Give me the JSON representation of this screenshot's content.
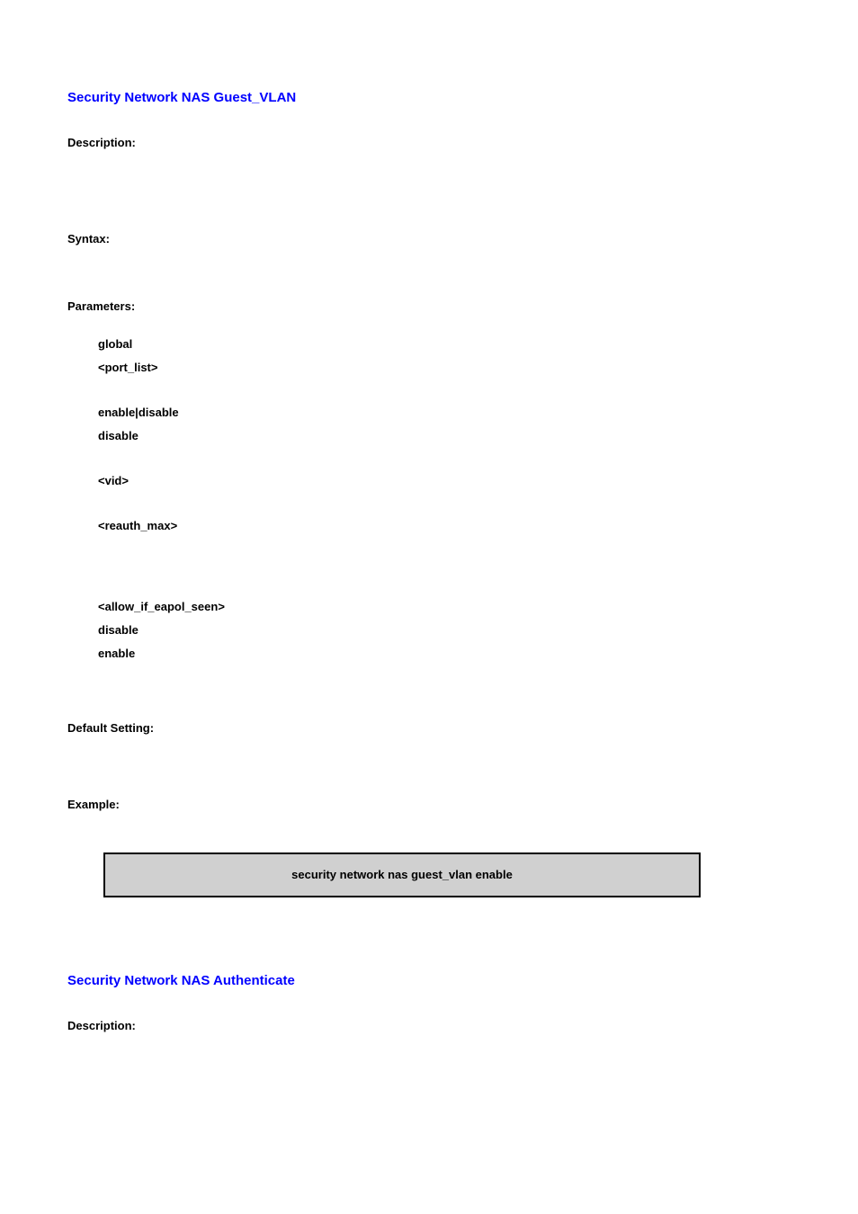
{
  "section1": {
    "title": "Security Network NAS Guest_VLAN",
    "description_label": "Description:",
    "syntax_label": "Syntax:",
    "parameters_label": "Parameters:",
    "params": [
      "global",
      "<port_list>",
      "",
      "enable|disable",
      "disable",
      "",
      "<vid>",
      "",
      "<reauth_max>",
      "",
      "",
      "<allow_if_eapol_seen>",
      "disable",
      "enable"
    ],
    "default_label": "Default Setting:",
    "example_label": "Example:",
    "example_code": "security network nas guest_vlan enable"
  },
  "section2": {
    "title": "Security Network NAS Authenticate",
    "description_label": "Description:"
  }
}
